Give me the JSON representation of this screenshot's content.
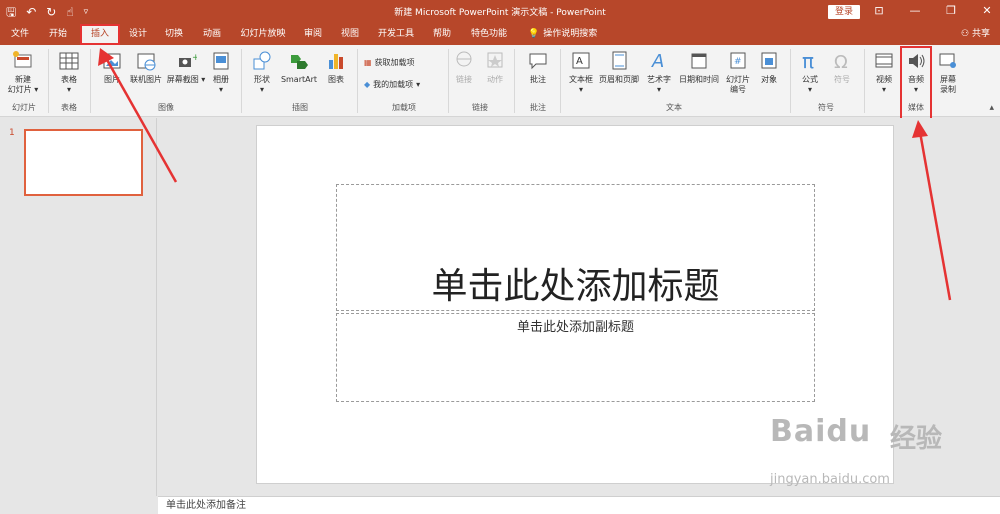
{
  "titlebar": {
    "title": "新建 Microsoft PowerPoint 演示文稿 - PowerPoint",
    "login_label": "登录",
    "qat_icons": [
      "save-icon",
      "undo-icon",
      "redo-icon",
      "touch-mode-icon",
      "customize-qat-icon"
    ],
    "window_controls": [
      "ribbon-display-icon",
      "minimize-icon",
      "restore-icon",
      "close-icon"
    ]
  },
  "tabs": [
    {
      "label": "文件"
    },
    {
      "label": "开始"
    },
    {
      "label": "插入"
    },
    {
      "label": "设计"
    },
    {
      "label": "切换"
    },
    {
      "label": "动画"
    },
    {
      "label": "幻灯片放映"
    },
    {
      "label": "审阅"
    },
    {
      "label": "视图"
    },
    {
      "label": "开发工具"
    },
    {
      "label": "帮助"
    },
    {
      "label": "特色功能"
    }
  ],
  "tellme": {
    "label": "操作说明搜索"
  },
  "share": {
    "label": "共享"
  },
  "ribbon": {
    "slides": {
      "new_slide_line1": "新建",
      "new_slide_line2": "幻灯片",
      "group": "幻灯片"
    },
    "tables": {
      "table": "表格",
      "group": "表格"
    },
    "images": {
      "picture": "图片",
      "online_picture": "联机图片",
      "screenshot": "屏幕截图",
      "album": "相册",
      "group": "图像"
    },
    "illustrations": {
      "shapes": "形状",
      "smartart": "SmartArt",
      "chart": "图表",
      "group": "插图"
    },
    "addins": {
      "get": "获取加载项",
      "my": "我的加载项",
      "group": "加载项"
    },
    "links": {
      "link": "链接",
      "action": "动作",
      "group": "链接"
    },
    "comments": {
      "comment": "批注",
      "group": "批注"
    },
    "text": {
      "textbox": "文本框",
      "header_footer": "页眉和页脚",
      "wordart": "艺术字",
      "datetime": "日期和时间",
      "slide_number_line1": "幻灯片",
      "slide_number_line2": "编号",
      "object": "对象",
      "group": "文本"
    },
    "symbols": {
      "equation": "公式",
      "symbol": "符号",
      "group": "符号"
    },
    "media": {
      "video": "视频",
      "audio": "音频",
      "screen_rec_line1": "屏幕",
      "screen_rec_line2": "录制",
      "group": "媒体"
    }
  },
  "slides_pane": {
    "slide_number": "1"
  },
  "slide": {
    "title_placeholder": "单击此处添加标题",
    "subtitle_placeholder": "单击此处添加副标题"
  },
  "notes": {
    "placeholder": "单击此处添加备注"
  },
  "watermark": {
    "brand": "Baidu",
    "brand_cn": "经验",
    "url": "jingyan.baidu.com"
  },
  "colors": {
    "accent": "#b7472a",
    "highlight": "#e53333"
  }
}
